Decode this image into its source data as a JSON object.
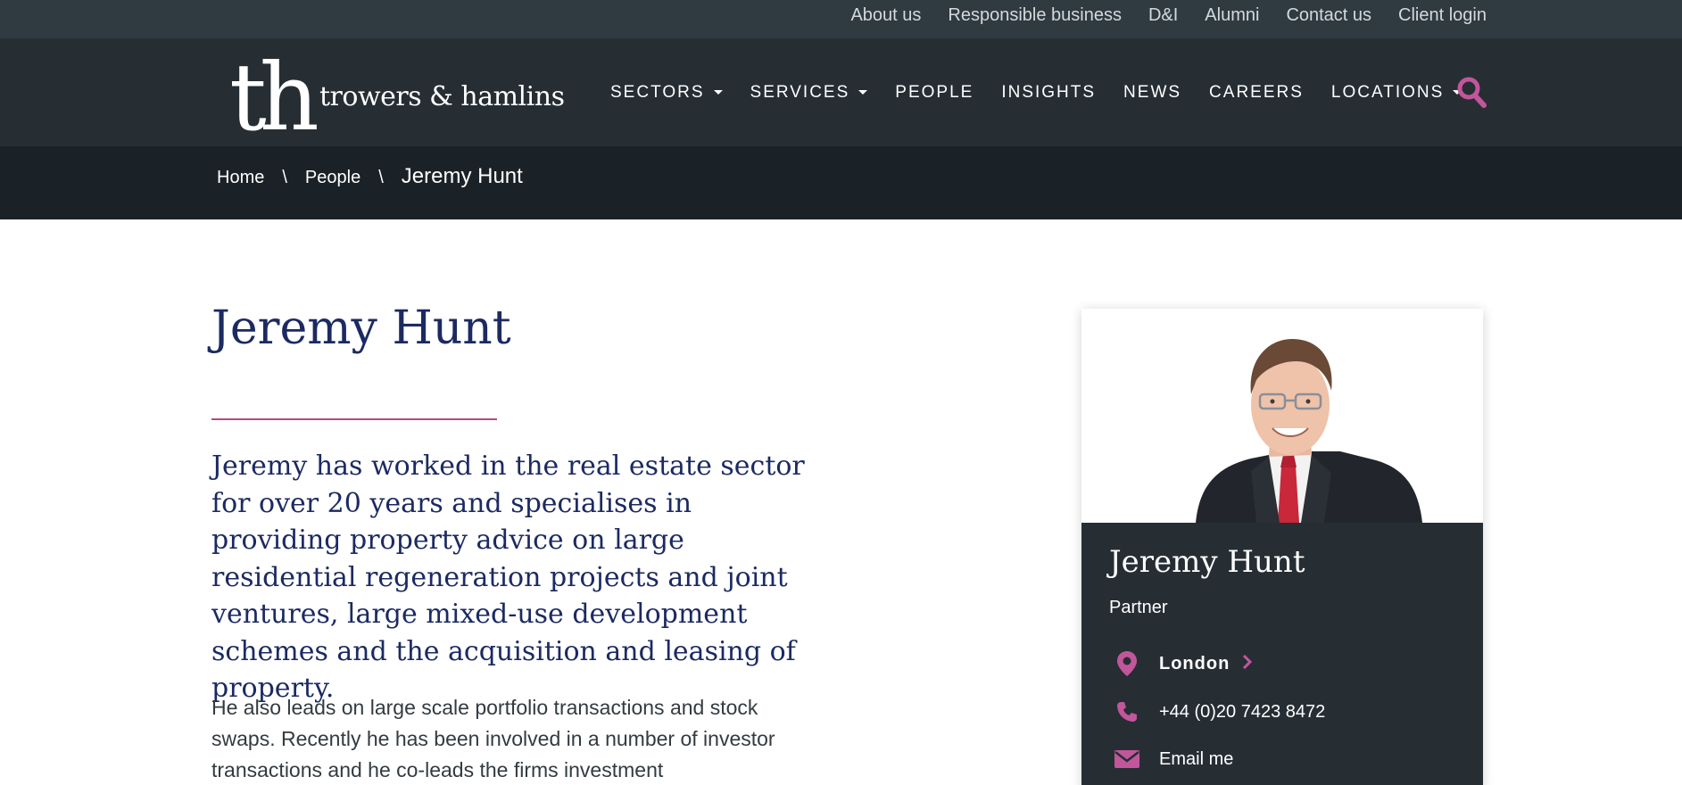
{
  "utility_nav": [
    {
      "label": "About us"
    },
    {
      "label": "Responsible business"
    },
    {
      "label": "D&I"
    },
    {
      "label": "Alumni"
    },
    {
      "label": "Contact us"
    },
    {
      "label": "Client login"
    }
  ],
  "brand": {
    "monogram": "th",
    "name": "trowers & hamlins"
  },
  "main_nav": [
    {
      "label": "SECTORS",
      "has_dropdown": true
    },
    {
      "label": "SERVICES",
      "has_dropdown": true
    },
    {
      "label": "PEOPLE",
      "has_dropdown": false
    },
    {
      "label": "INSIGHTS",
      "has_dropdown": false
    },
    {
      "label": "NEWS",
      "has_dropdown": false
    },
    {
      "label": "CAREERS",
      "has_dropdown": false
    },
    {
      "label": "LOCATIONS",
      "has_dropdown": true
    }
  ],
  "search": {
    "icon": "search-icon"
  },
  "breadcrumb": {
    "home": "Home",
    "section": "People",
    "current": "Jeremy Hunt",
    "separator": "\\"
  },
  "profile": {
    "name": "Jeremy Hunt",
    "lead": "Jeremy has worked in the real estate sector for over 20 years and specialises in providing property advice on large residential regeneration projects and joint ventures, large mixed-use development schemes and the acquisition and leasing of property.",
    "body": "He also leads on large scale portfolio transactions and stock swaps. Recently he has been involved in a number of investor transactions and he co-leads the firms investment"
  },
  "card": {
    "name": "Jeremy Hunt",
    "role": "Partner",
    "location": "London",
    "phone": "+44 (0)20 7423 8472",
    "email_label": "Email me"
  },
  "colors": {
    "utility_bg": "#2f3a41",
    "header_bg": "#262e34",
    "breadcrumb_bg": "#1b2227",
    "accent": "#c2569b",
    "heading": "#1c2a62"
  }
}
